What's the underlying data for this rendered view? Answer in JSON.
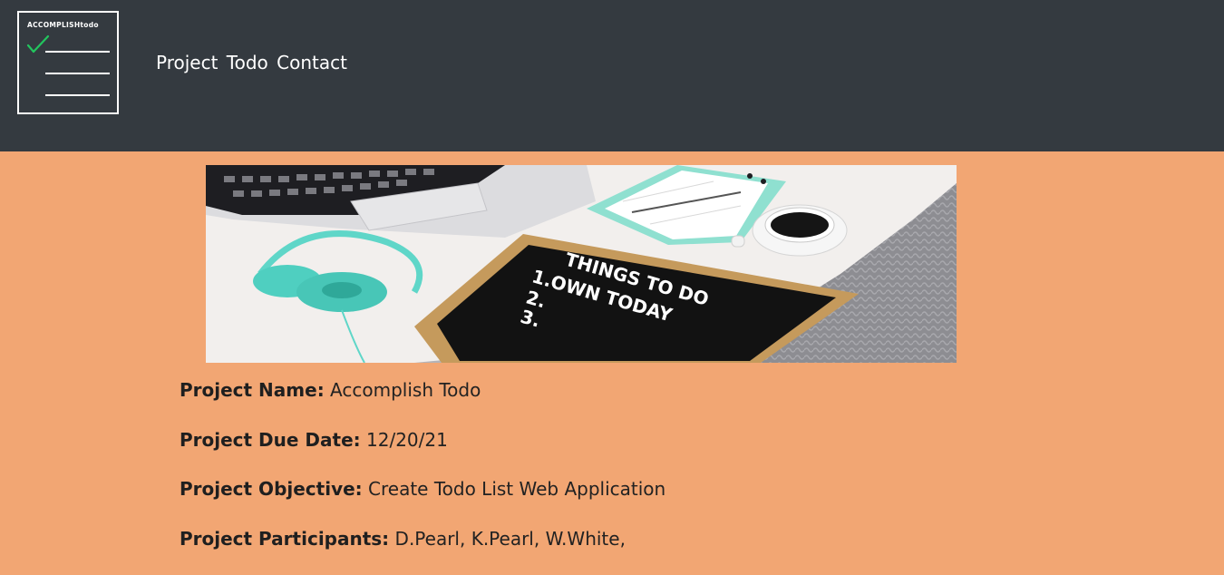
{
  "navbar": {
    "logo_text": "ACCOMPLISHtodo",
    "links": [
      "Project",
      "Todo",
      "Contact"
    ]
  },
  "hero": {
    "board_line_1": "THINGS TO DO",
    "board_line_2": "1.OWN TODAY",
    "board_line_3": "2.",
    "board_line_4": "3."
  },
  "details": [
    {
      "label": "Project Name:",
      "value": " Accomplish Todo"
    },
    {
      "label": "Project Due Date:",
      "value": " 12/20/21"
    },
    {
      "label": "Project Objective:",
      "value": " Create Todo List Web Application"
    },
    {
      "label": "Project Participants:",
      "value": " D.Pearl, K.Pearl, W.White,"
    }
  ],
  "colors": {
    "navbar_bg": "#343a40",
    "page_bg": "#f2a673",
    "check_green": "#22c55e"
  }
}
